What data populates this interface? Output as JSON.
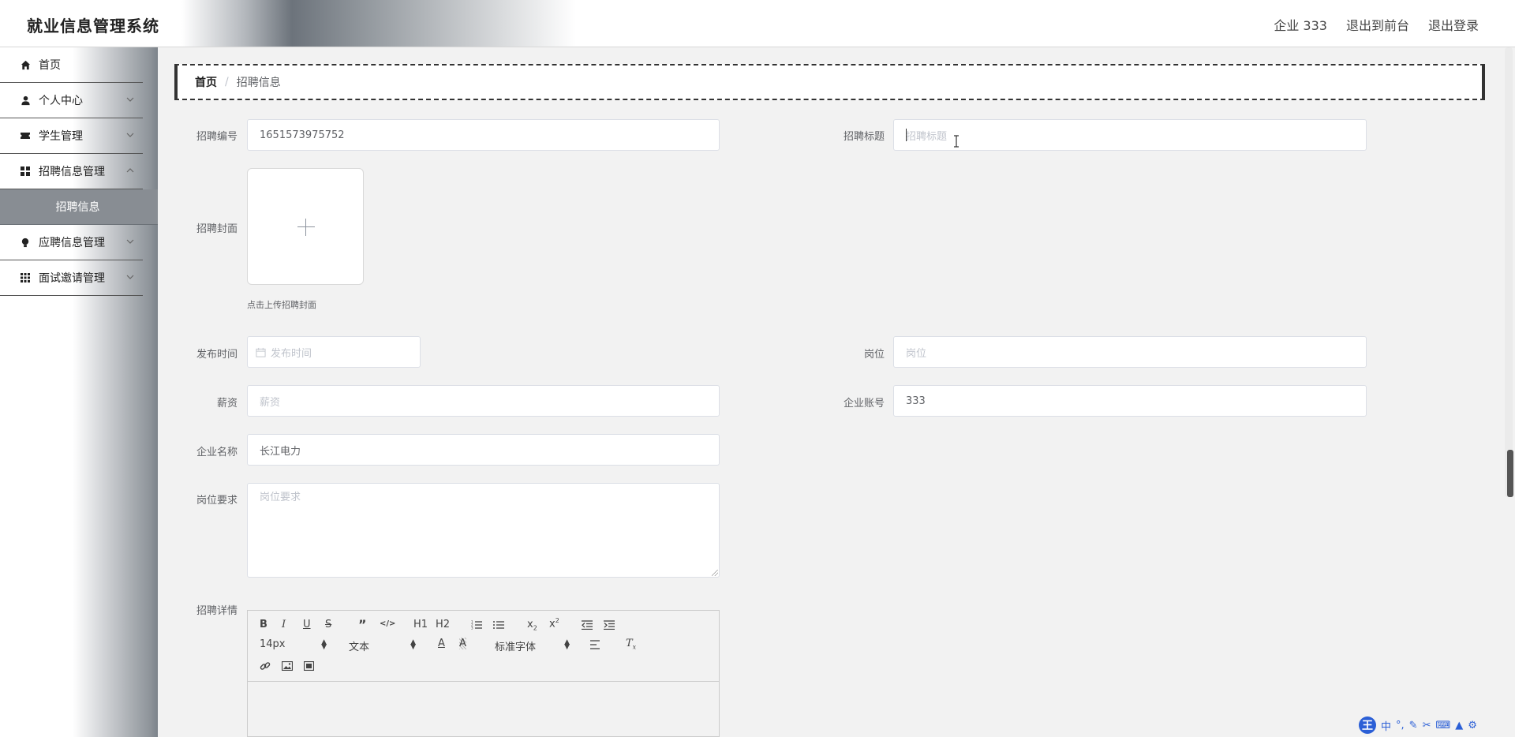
{
  "app": {
    "title": "就业信息管理系统"
  },
  "header": {
    "user": "企业 333",
    "to_front": "退出到前台",
    "logout": "退出登录"
  },
  "sidebar": {
    "items": [
      {
        "label": "首页",
        "icon": "home-icon"
      },
      {
        "label": "个人中心",
        "icon": "user-icon"
      },
      {
        "label": "学生管理",
        "icon": "ticket-icon"
      },
      {
        "label": "招聘信息管理",
        "icon": "grid-icon"
      },
      {
        "label": "应聘信息管理",
        "icon": "bulb-icon"
      },
      {
        "label": "面试邀请管理",
        "icon": "apps-icon"
      }
    ],
    "active_sub": "招聘信息"
  },
  "breadcrumb": {
    "home": "首页",
    "separator": "/",
    "current": "招聘信息"
  },
  "form": {
    "recruit_no": {
      "label": "招聘编号",
      "value": "1651573975752"
    },
    "recruit_title": {
      "label": "招聘标题",
      "placeholder": "招聘标题"
    },
    "cover": {
      "label": "招聘封面",
      "tip": "点击上传招聘封面"
    },
    "publish_time": {
      "label": "发布时间",
      "placeholder": "发布时间"
    },
    "position": {
      "label": "岗位",
      "placeholder": "岗位"
    },
    "salary": {
      "label": "薪资",
      "placeholder": "薪资"
    },
    "company_account": {
      "label": "企业账号",
      "value": "333"
    },
    "company_name": {
      "label": "企业名称",
      "value": "长江电力"
    },
    "requirements": {
      "label": "岗位要求",
      "placeholder": "岗位要求"
    },
    "details": {
      "label": "招聘详情"
    }
  },
  "editor": {
    "font_size": "14px",
    "block_type": "文本",
    "font_family": "标准字体",
    "h1": "H1",
    "h2": "H2"
  },
  "ime": {
    "lang": "中",
    "logo": "王"
  },
  "colors": {
    "accent_gray": "#888d93",
    "border": "#dcdfe6",
    "placeholder": "#c0c4cc"
  }
}
